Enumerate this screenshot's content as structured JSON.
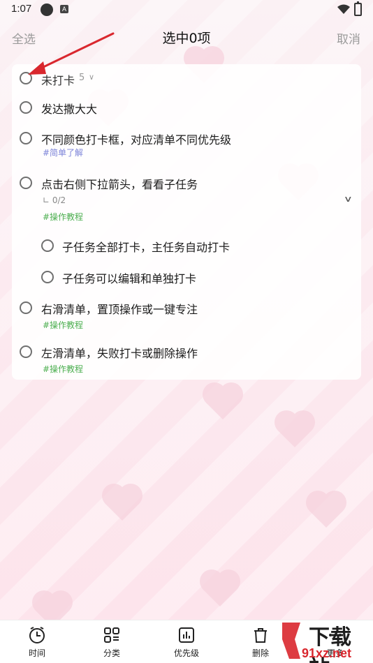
{
  "status_bar": {
    "time": "1:07",
    "icon_a": "A"
  },
  "header": {
    "select_all": "全选",
    "title": "选中0项",
    "cancel": "取消"
  },
  "group": {
    "label": "未打卡",
    "count": "5"
  },
  "tasks": [
    {
      "text": "发达撒大大"
    },
    {
      "text": "不同颜色打卡框，对应清单不同优先级",
      "tag": "#简单了解"
    },
    {
      "text": "点击右侧下拉箭头，看看子任务",
      "subtask_count": "0/2",
      "tag": "#操作教程"
    },
    {
      "text": "子任务全部打卡，主任务自动打卡"
    },
    {
      "text": "子任务可以编辑和单独打卡"
    },
    {
      "text": "右滑清单，置顶操作或一键专注",
      "tag": "#操作教程"
    },
    {
      "text": "左滑清单，失败打卡或删除操作",
      "tag": "#操作教程"
    }
  ],
  "bottom_tabs": [
    {
      "label": "时间",
      "icon": "clock-icon"
    },
    {
      "label": "分类",
      "icon": "grid-icon"
    },
    {
      "label": "优先级",
      "icon": "bar-chart-icon"
    },
    {
      "label": "删除",
      "icon": "trash-icon"
    },
    {
      "label": "更多",
      "icon": "more-icon"
    }
  ],
  "watermark": {
    "text1": "下载站",
    "text2": "91xz.net"
  },
  "colors": {
    "accent_red": "#d9272e",
    "tag_green": "#4caf50",
    "tag_blue": "#7d84d9"
  }
}
